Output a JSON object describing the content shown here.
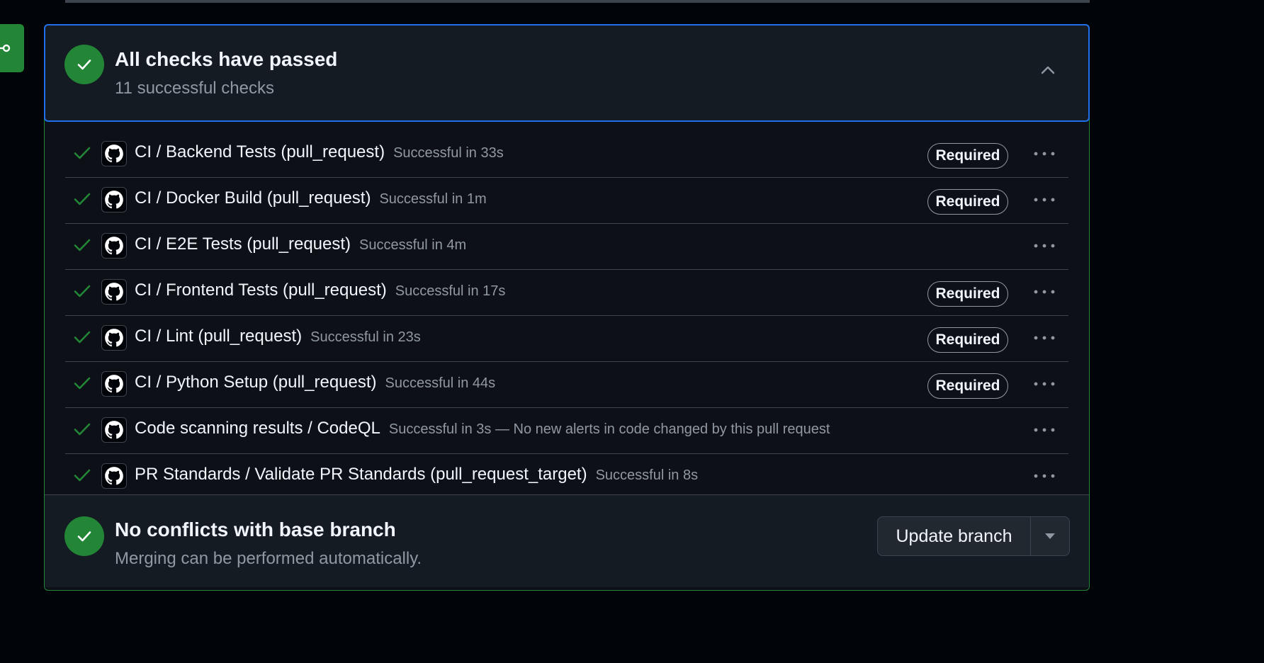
{
  "colors": {
    "success": "#238636",
    "focus_border": "#1f6feb",
    "muted_text": "#9198a1",
    "background": "#010409"
  },
  "checks_summary": {
    "title": "All checks have passed",
    "subtitle": "11 successful checks",
    "status_icon": "check-icon",
    "toggle_icon": "chevron-up-icon"
  },
  "checks": [
    {
      "name": "CI / Backend Tests (pull_request)",
      "status": "Successful in 33s",
      "required": "Required"
    },
    {
      "name": "CI / Docker Build (pull_request)",
      "status": "Successful in 1m",
      "required": "Required"
    },
    {
      "name": "CI / E2E Tests (pull_request)",
      "status": "Successful in 4m",
      "required": ""
    },
    {
      "name": "CI / Frontend Tests (pull_request)",
      "status": "Successful in 17s",
      "required": "Required"
    },
    {
      "name": "CI / Lint (pull_request)",
      "status": "Successful in 23s",
      "required": "Required"
    },
    {
      "name": "CI / Python Setup (pull_request)",
      "status": "Successful in 44s",
      "required": "Required"
    },
    {
      "name": "Code scanning results / CodeQL",
      "status": "Successful in 3s — No new alerts in code changed by this pull request",
      "required": ""
    },
    {
      "name": "PR Standards / Validate PR Standards (pull_request_target)",
      "status": "Successful in 8s",
      "required": ""
    }
  ],
  "merge": {
    "title": "No conflicts with base branch",
    "subtitle": "Merging can be performed automatically.",
    "update_button": "Update branch",
    "dropdown_icon": "caret-down-icon"
  }
}
